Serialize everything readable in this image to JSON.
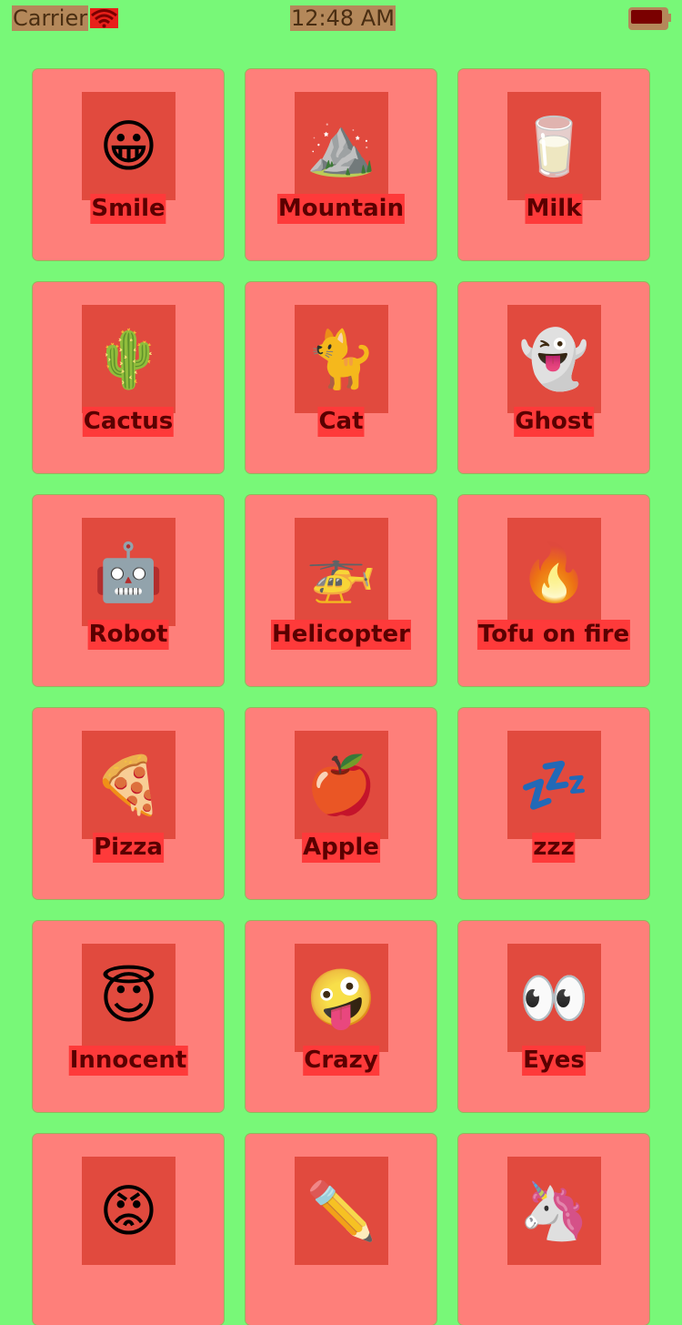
{
  "status_bar": {
    "carrier": "Carrier",
    "time": "12:48 AM",
    "wifi_icon": "wifi-icon",
    "battery_icon": "battery-icon"
  },
  "colors": {
    "background": "#78f878",
    "card": "#fe7f7a",
    "icon_box": "#e14a3e",
    "label_bg": "#fe3a3a",
    "label_text": "#5a0000"
  },
  "items": [
    {
      "label": "Smile",
      "emoji": "😀",
      "icon": "smile-icon"
    },
    {
      "label": "Mountain",
      "emoji": "⛰️",
      "icon": "mountain-icon"
    },
    {
      "label": "Milk",
      "emoji": "🥛",
      "icon": "milk-icon"
    },
    {
      "label": "Cactus",
      "emoji": "🌵",
      "icon": "cactus-icon"
    },
    {
      "label": "Cat",
      "emoji": "🐈",
      "icon": "cat-icon"
    },
    {
      "label": "Ghost",
      "emoji": "👻",
      "icon": "ghost-icon"
    },
    {
      "label": "Robot",
      "emoji": "🤖",
      "icon": "robot-icon"
    },
    {
      "label": "Helicopter",
      "emoji": "🚁",
      "icon": "helicopter-icon"
    },
    {
      "label": "Tofu on fire",
      "emoji": "🔥",
      "icon": "tofu-on-fire-icon"
    },
    {
      "label": "Pizza",
      "emoji": "🍕",
      "icon": "pizza-icon"
    },
    {
      "label": "Apple",
      "emoji": "🍎",
      "icon": "apple-icon"
    },
    {
      "label": "zzz",
      "emoji": "💤",
      "icon": "zzz-icon"
    },
    {
      "label": "Innocent",
      "emoji": "😇",
      "icon": "innocent-icon"
    },
    {
      "label": "Crazy",
      "emoji": "🤪",
      "icon": "crazy-icon"
    },
    {
      "label": "Eyes",
      "emoji": "👀",
      "icon": "eyes-icon"
    },
    {
      "label": "",
      "emoji": "😡",
      "icon": "angry-icon"
    },
    {
      "label": "",
      "emoji": "✏️",
      "icon": "pencil-icon"
    },
    {
      "label": "",
      "emoji": "🦄",
      "icon": "unicorn-icon"
    }
  ]
}
